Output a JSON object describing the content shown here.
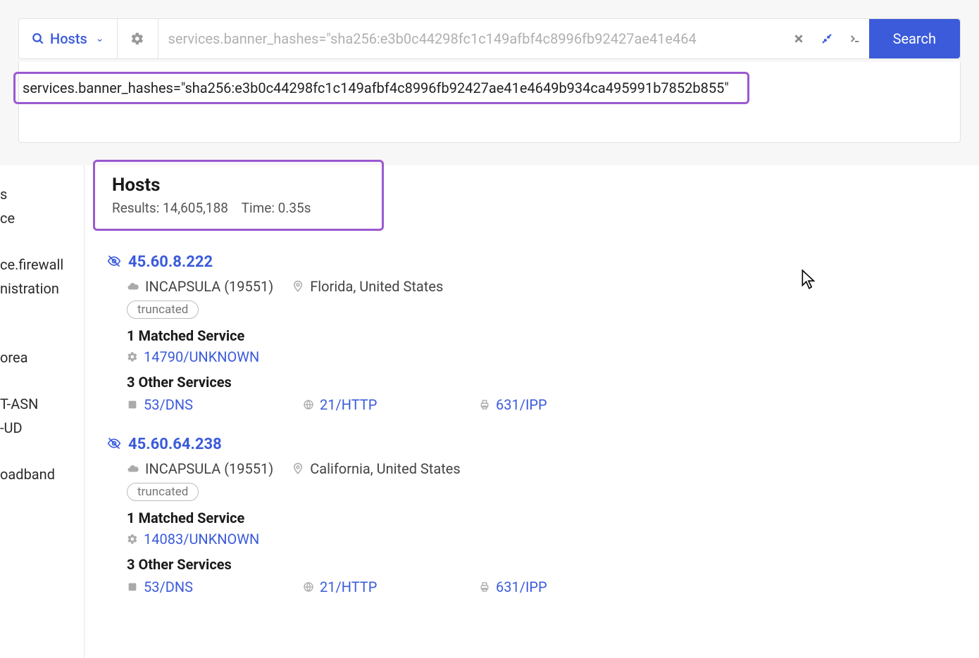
{
  "topbar": {
    "hosts_label": "Hosts",
    "search_placeholder": "services.banner_hashes=\"sha256:e3b0c44298fc1c149afbf4c8996fb92427ae41e464",
    "search_button": "Search"
  },
  "full_query": "services.banner_hashes=\"sha256:e3b0c44298fc1c149afbf4c8996fb92427ae41e4649b934ca495991b7852b855\"",
  "hosts_header": {
    "title": "Hosts",
    "results_label": "Results: 14,605,188",
    "time_label": "Time: 0.35s"
  },
  "sidebar_fragments": [
    "s",
    "ce",
    "",
    "ce.firewall",
    "nistration",
    "",
    "",
    "orea",
    "",
    "T-ASN",
    "UD-",
    "",
    "oadband"
  ],
  "results": [
    {
      "ip": "45.60.8.222",
      "asn": "INCAPSULA (19551)",
      "location": "Florida, United States",
      "tag": "truncated",
      "matched_head": "1 Matched Service",
      "matched_service": "14790/UNKNOWN",
      "other_head": "3 Other Services",
      "other_services": [
        "53/DNS",
        "21/HTTP",
        "631/IPP"
      ]
    },
    {
      "ip": "45.60.64.238",
      "asn": "INCAPSULA (19551)",
      "location": "California, United States",
      "tag": "truncated",
      "matched_head": "1 Matched Service",
      "matched_service": "14083/UNKNOWN",
      "other_head": "3 Other Services",
      "other_services": [
        "53/DNS",
        "21/HTTP",
        "631/IPP"
      ]
    }
  ]
}
